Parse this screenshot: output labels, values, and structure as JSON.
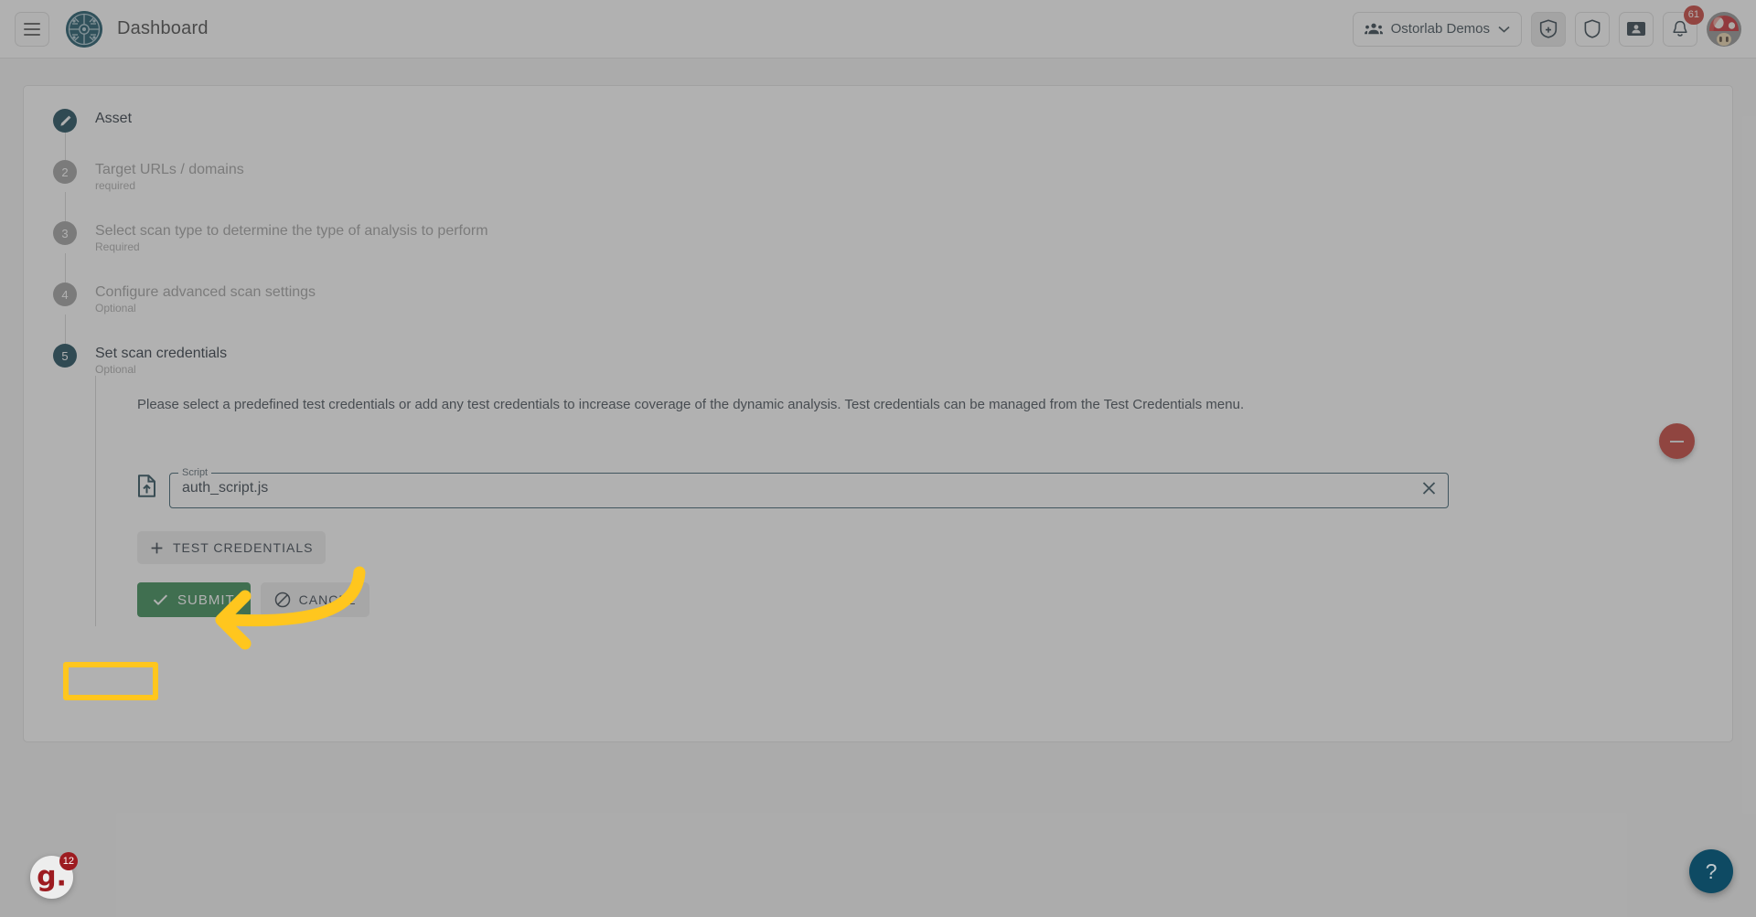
{
  "header": {
    "title": "Dashboard",
    "menu_icon": "hamburger-menu-icon",
    "logo_icon": "ostorlab-circuit-logo",
    "org": {
      "name": "Ostorlab Demos",
      "group_icon": "group-people-icon",
      "chevron_icon": "chevron-down-icon"
    },
    "actions": [
      {
        "icon": "shield-plus-icon",
        "label": ""
      },
      {
        "icon": "shield-icon",
        "label": ""
      },
      {
        "icon": "id-card-icon",
        "label": ""
      }
    ],
    "notifications": {
      "icon": "bell-icon",
      "count": "61"
    },
    "avatar": "mushroom-avatar"
  },
  "stepper": {
    "steps": [
      {
        "index": "1",
        "label": "Asset",
        "sub": "",
        "state": "done",
        "icon": "pencil-edit-icon"
      },
      {
        "index": "2",
        "label": "Target URLs / domains",
        "sub": "required",
        "state": "pending"
      },
      {
        "index": "3",
        "label": "Select scan type to determine the type of analysis to perform",
        "sub": "Required",
        "state": "pending"
      },
      {
        "index": "4",
        "label": "Configure advanced scan settings",
        "sub": "Optional",
        "state": "pending"
      },
      {
        "index": "5",
        "label": "Set scan credentials",
        "sub": "Optional",
        "state": "active"
      }
    ]
  },
  "credentials_panel": {
    "description": "Please select a predefined test credentials or add any test credentials to increase coverage of the dynamic analysis. Test credentials can be managed from the Test Credentials menu.",
    "remove_row_button": {
      "icon": "minus-icon",
      "label": ""
    },
    "script_field": {
      "label": "Script",
      "value": "auth_script.js",
      "placeholder": "",
      "leading_icon": "file-upload-icon",
      "clear_icon": "close-x-icon"
    },
    "add_credentials_button": {
      "label": "TEST CREDENTIALS",
      "icon": "plus-icon"
    },
    "submit_button": {
      "label": "SUBMIT",
      "icon": "check-icon"
    },
    "cancel_button": {
      "label": "CANCEL",
      "icon": "block-prohibited-icon"
    }
  },
  "annotation": {
    "arrow_color": "#ffc61e",
    "highlight_color": "#ffc61e",
    "target": "submit-button"
  },
  "floating": {
    "guide_widget": {
      "letter": "g.",
      "badge": "12"
    },
    "help_button": {
      "label": "?"
    }
  },
  "colors": {
    "accent_dark": "#0d3e4f",
    "submit_green": "#2a8348",
    "danger_red": "#c0342b",
    "badge_red": "#c4342c",
    "highlight_yellow": "#ffc61e"
  }
}
